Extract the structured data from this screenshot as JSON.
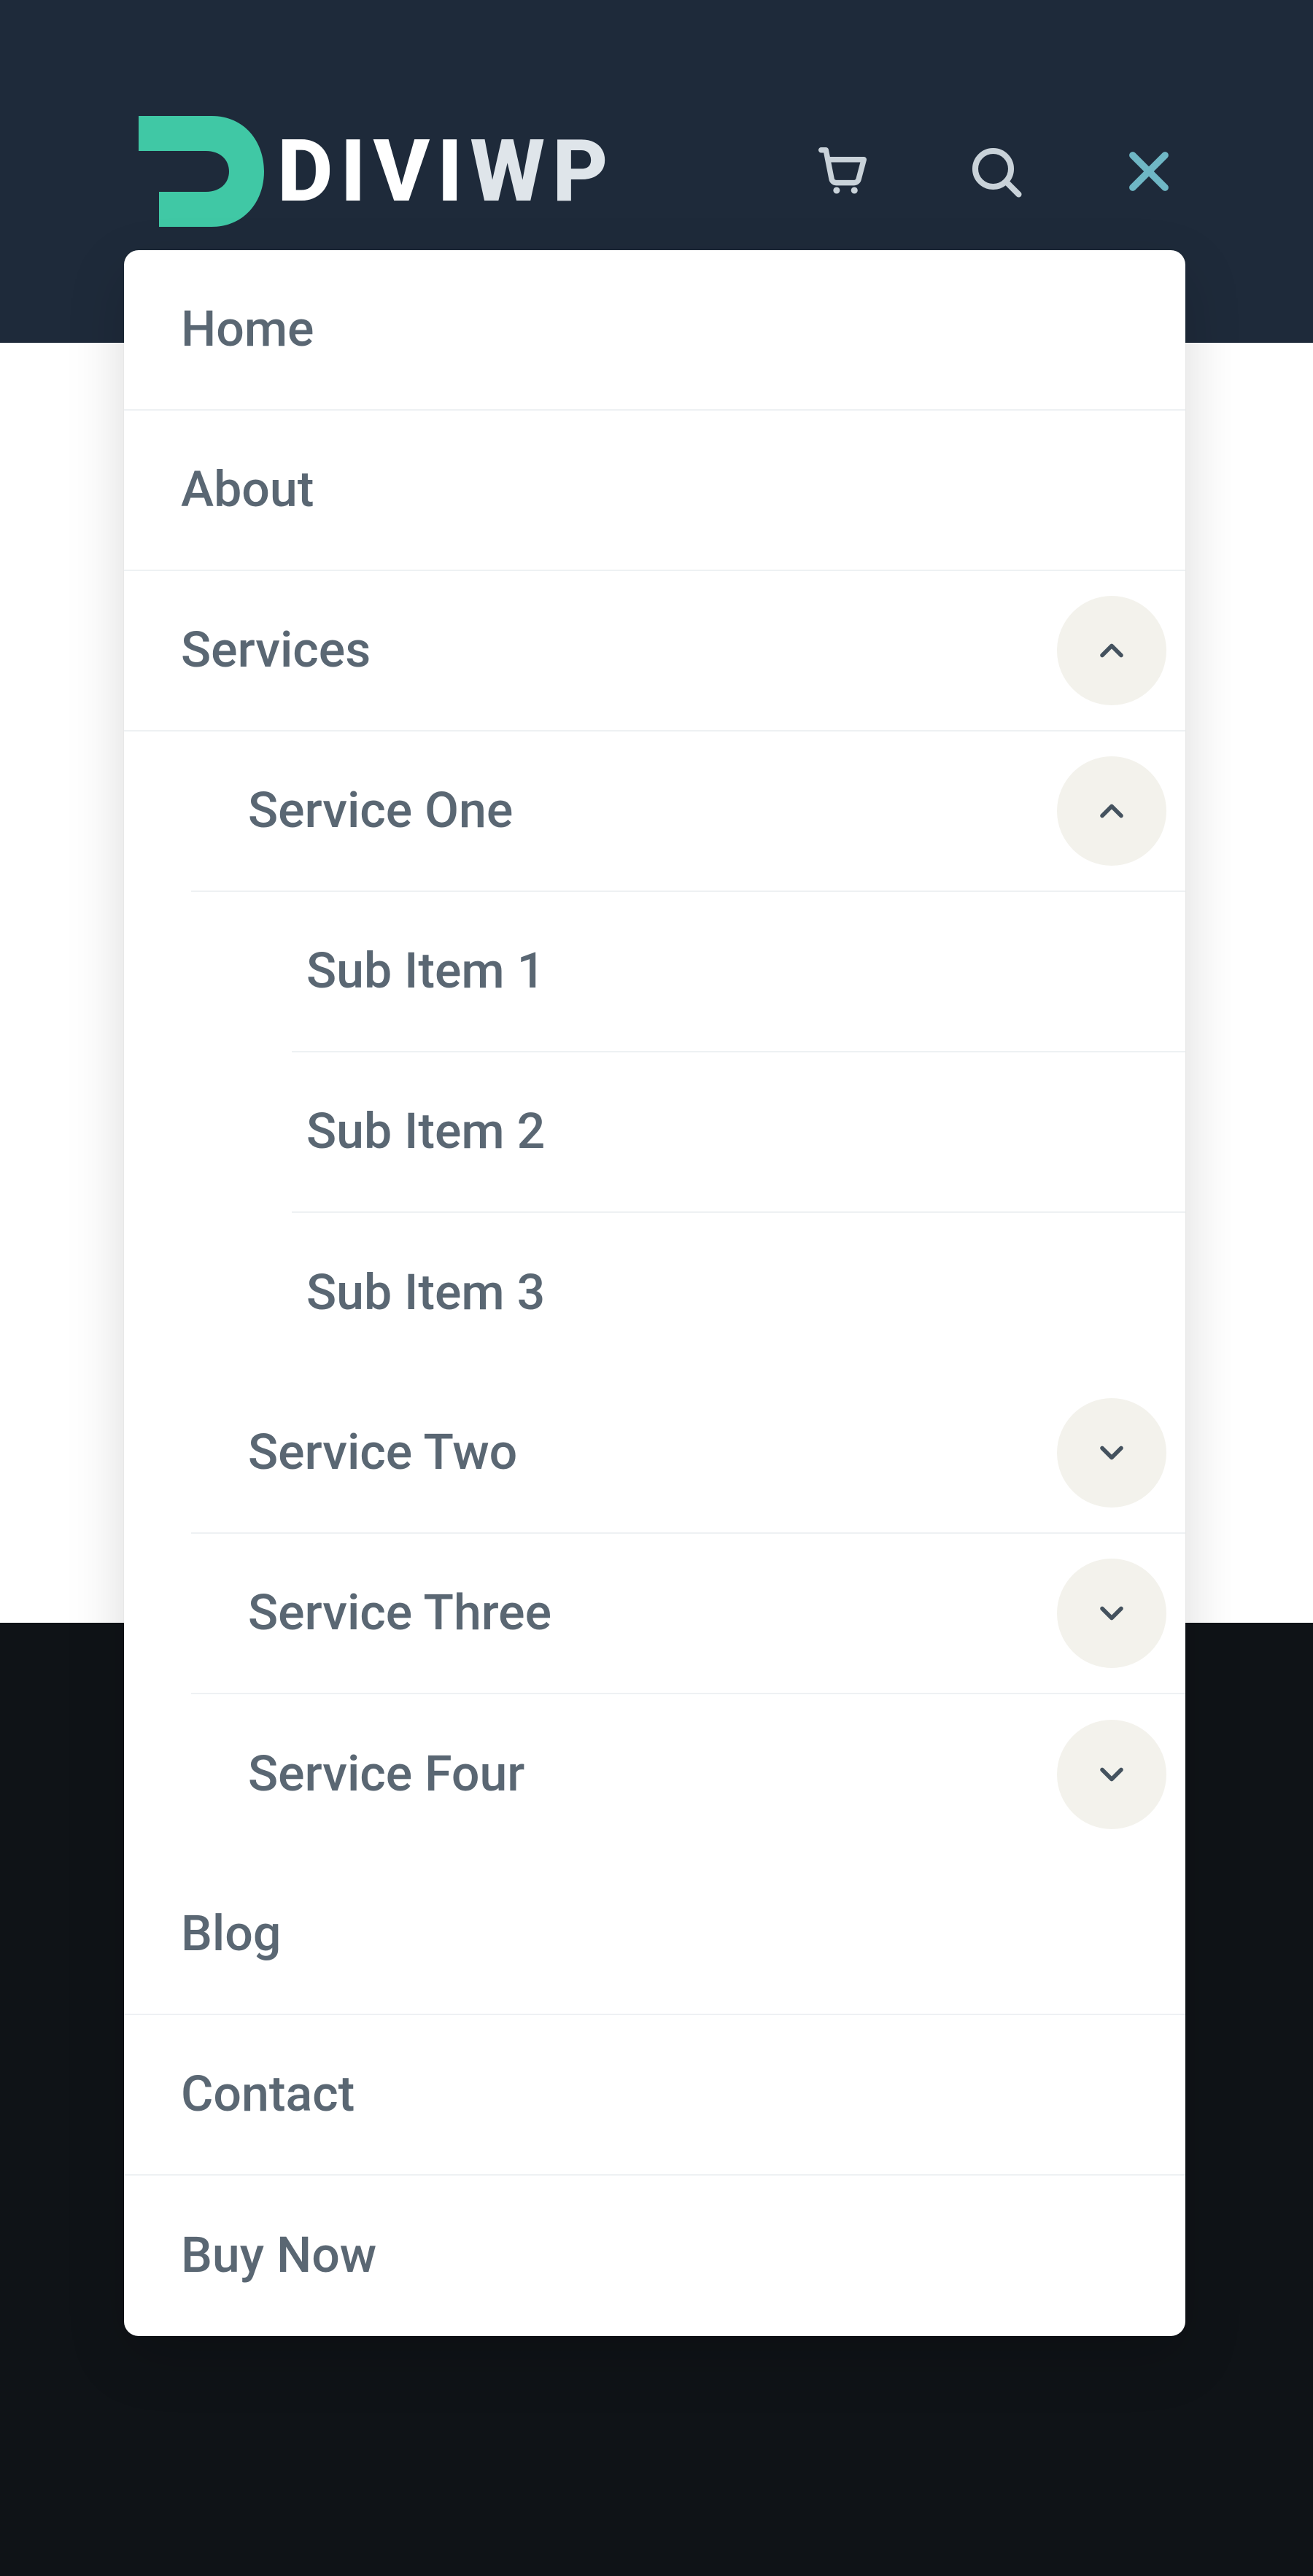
{
  "brand": {
    "name_part_a": "DIVI",
    "name_part_b": "WP",
    "accent_color": "#40c8a5",
    "header_bg": "#1e2a3a"
  },
  "header_icons": {
    "cart": "cart-icon",
    "search": "search-icon",
    "close": "close-icon"
  },
  "menu": {
    "items": [
      {
        "label": "Home"
      },
      {
        "label": "About"
      },
      {
        "label": "Services",
        "expanded": true,
        "children": [
          {
            "label": "Service One",
            "expanded": true,
            "children": [
              {
                "label": "Sub Item 1"
              },
              {
                "label": "Sub Item 2"
              },
              {
                "label": "Sub Item 3"
              }
            ]
          },
          {
            "label": "Service Two",
            "expanded": false,
            "children": []
          },
          {
            "label": "Service Three",
            "expanded": false,
            "children": []
          },
          {
            "label": "Service Four",
            "expanded": false,
            "children": []
          }
        ]
      },
      {
        "label": "Blog"
      },
      {
        "label": "Contact"
      },
      {
        "label": "Buy Now"
      }
    ]
  }
}
